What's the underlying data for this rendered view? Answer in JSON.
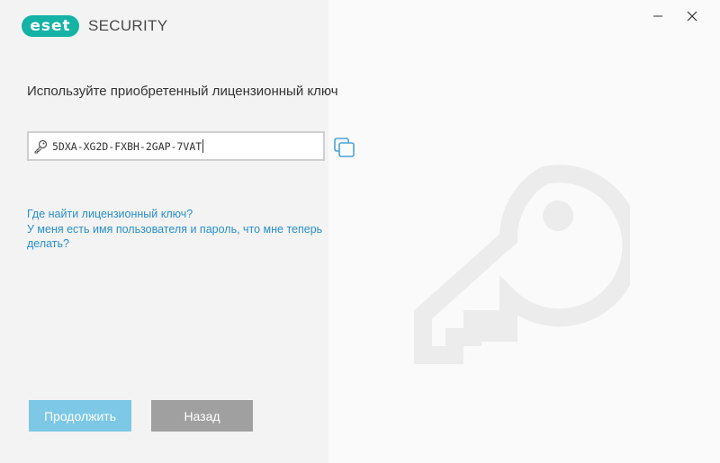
{
  "app": {
    "logo_text": "eset",
    "product": "SECURITY"
  },
  "window_controls": {
    "minimize_icon": "minimize-icon",
    "close_icon": "close-icon"
  },
  "main": {
    "heading": "Используйте приобретенный лицензионный ключ",
    "license_key_value": "5DXA-XG2D-FXBH-2GAP-7VAT",
    "links": [
      "Где найти лицензионный ключ?",
      "У меня есть имя пользователя и пароль, что мне теперь делать?"
    ]
  },
  "buttons": {
    "continue": "Продолжить",
    "back": "Назад"
  },
  "colors": {
    "brand": "#15b2a6",
    "link": "#2a8fc8",
    "primary_button": "#7cc8e6",
    "secondary_button": "#a0a0a0"
  }
}
